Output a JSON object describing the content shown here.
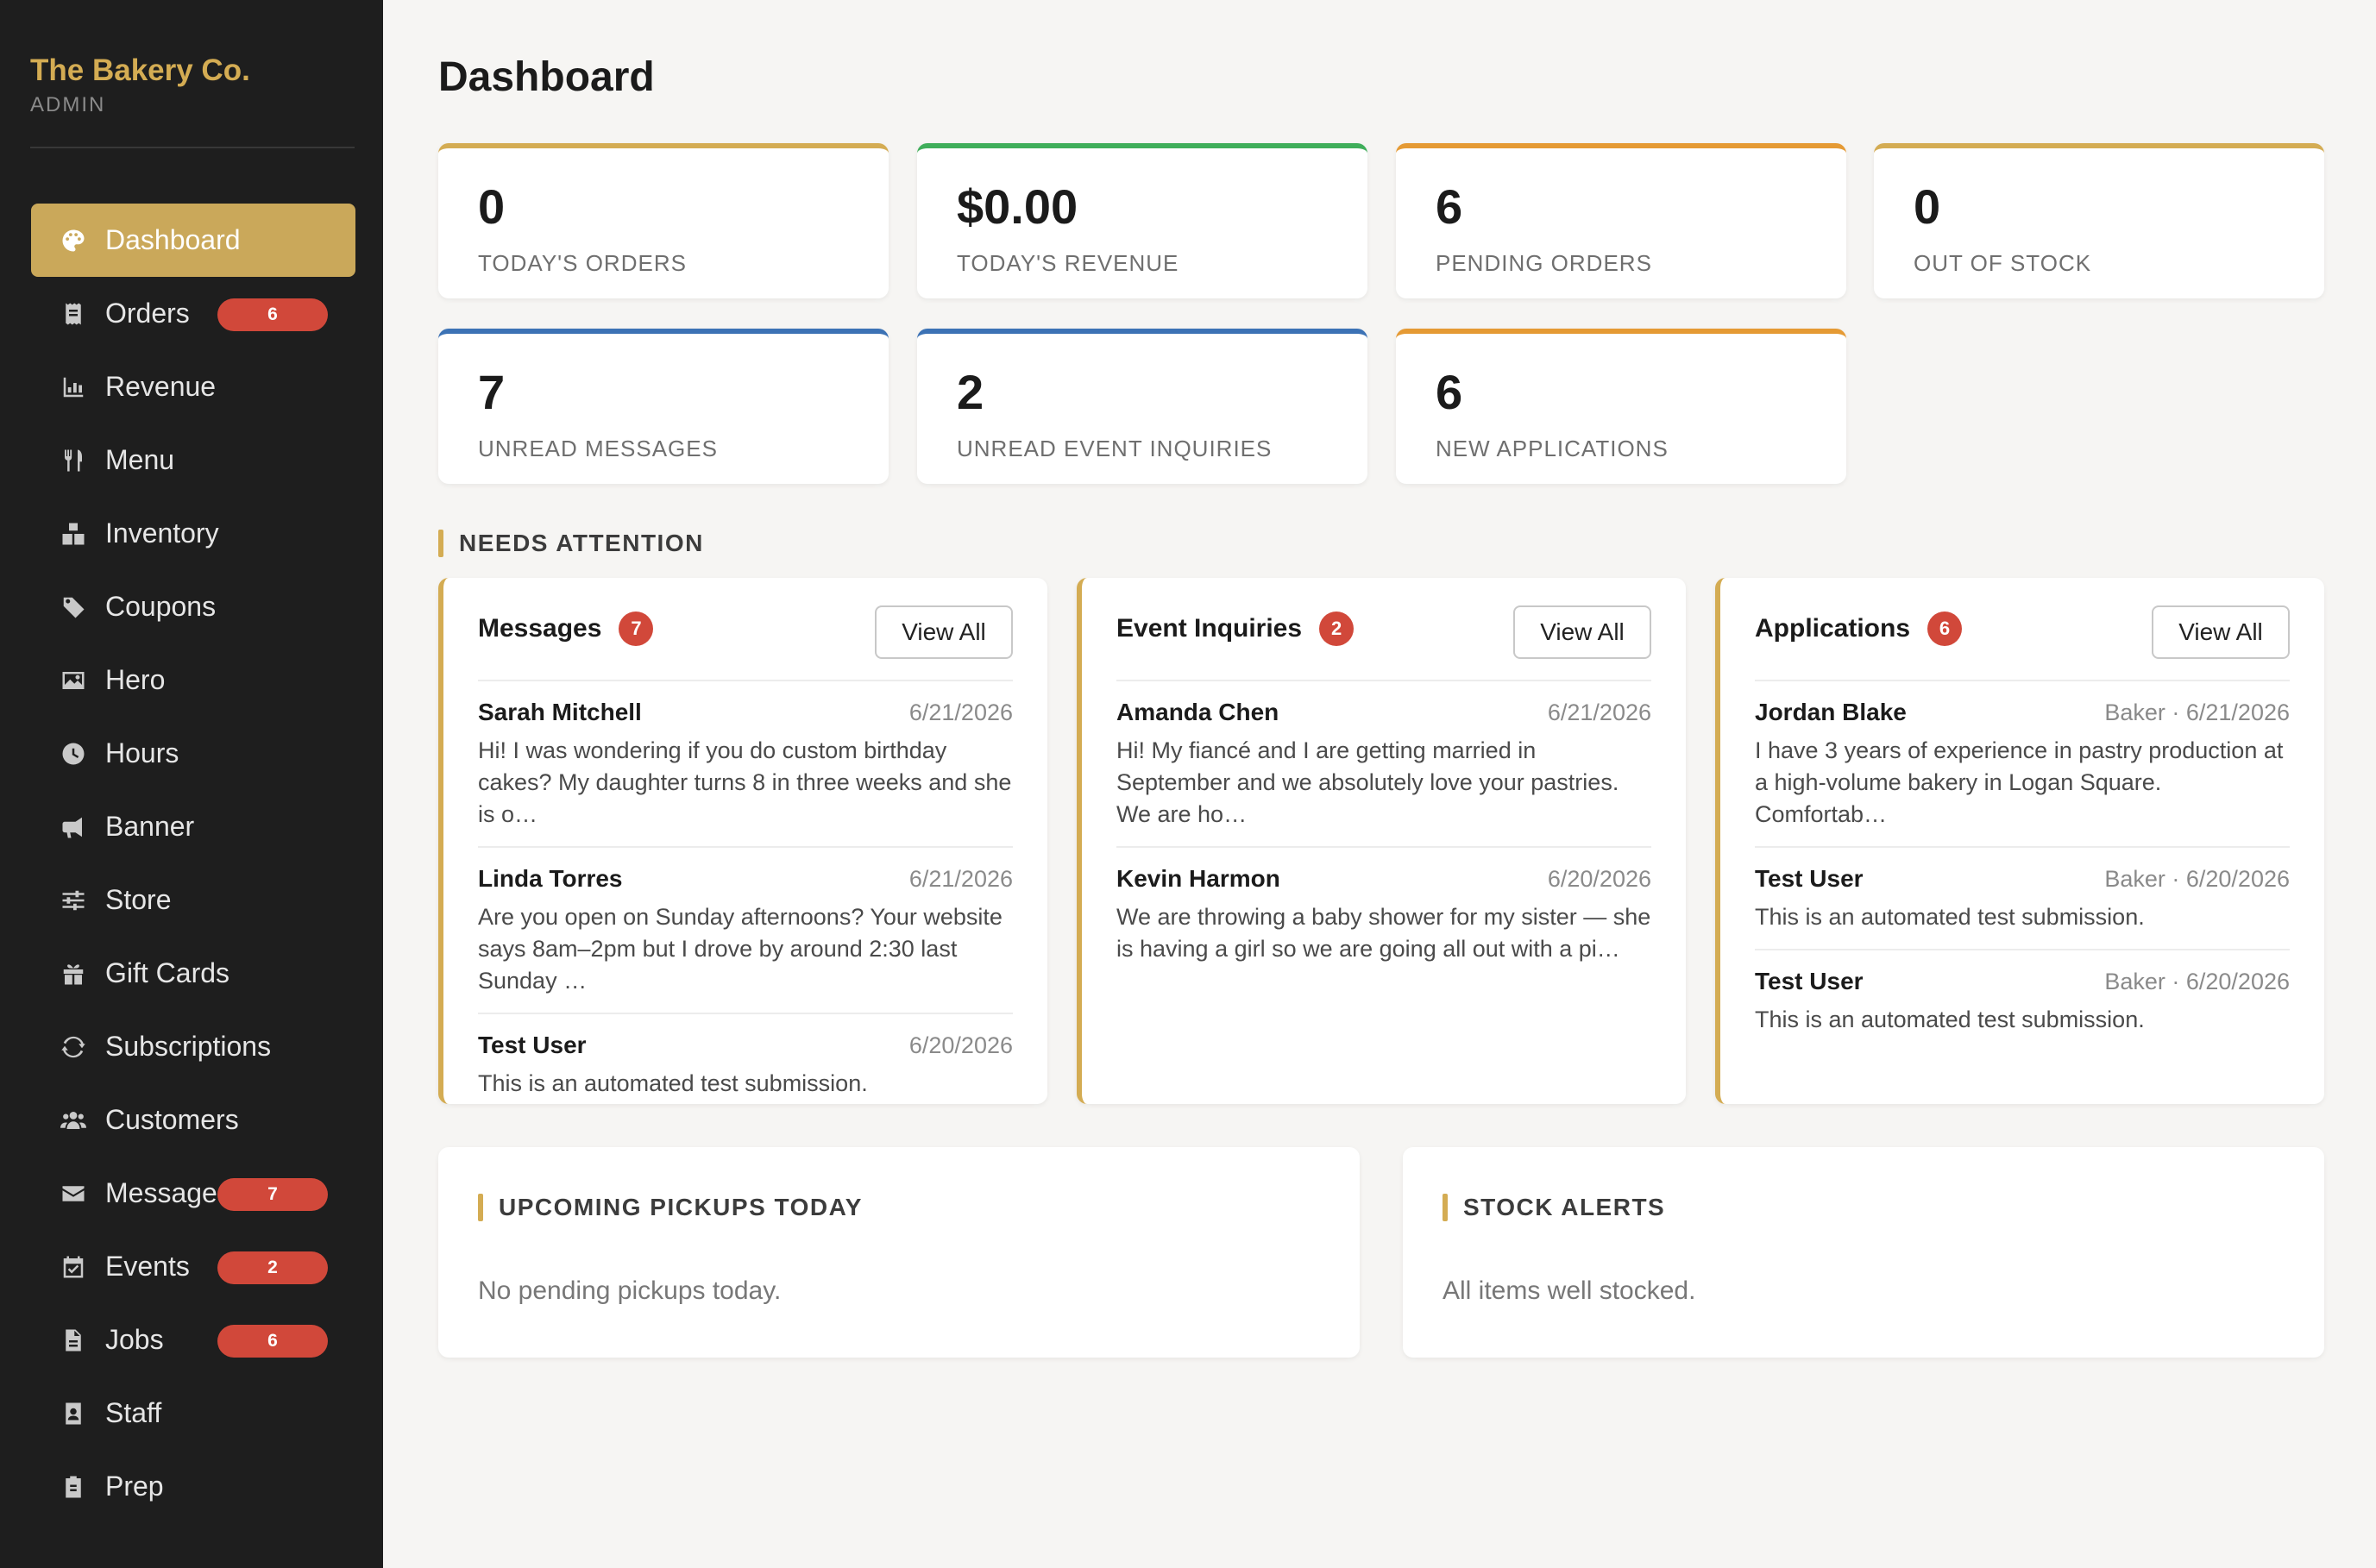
{
  "brand": {
    "name": "The Bakery Co.",
    "role": "ADMIN"
  },
  "sidebar": {
    "items": [
      {
        "label": "Dashboard",
        "icon": "palette-icon",
        "active": true,
        "badge": ""
      },
      {
        "label": "Orders",
        "icon": "receipt-icon",
        "badge": "6"
      },
      {
        "label": "Revenue",
        "icon": "bar-chart-icon",
        "badge": ""
      },
      {
        "label": "Menu",
        "icon": "utensils-icon",
        "badge": ""
      },
      {
        "label": "Inventory",
        "icon": "boxes-icon",
        "badge": ""
      },
      {
        "label": "Coupons",
        "icon": "tag-icon",
        "badge": ""
      },
      {
        "label": "Hero",
        "icon": "image-icon",
        "badge": ""
      },
      {
        "label": "Hours",
        "icon": "clock-icon",
        "badge": ""
      },
      {
        "label": "Banner",
        "icon": "megaphone-icon",
        "badge": ""
      },
      {
        "label": "Store",
        "icon": "sliders-icon",
        "badge": ""
      },
      {
        "label": "Gift Cards",
        "icon": "gift-icon",
        "badge": ""
      },
      {
        "label": "Subscriptions",
        "icon": "sync-icon",
        "badge": ""
      },
      {
        "label": "Customers",
        "icon": "users-icon",
        "badge": ""
      },
      {
        "label": "Messages",
        "icon": "envelope-icon",
        "badge": "7"
      },
      {
        "label": "Events",
        "icon": "calendar-check-icon",
        "badge": "2"
      },
      {
        "label": "Jobs",
        "icon": "file-icon",
        "badge": "6"
      },
      {
        "label": "Staff",
        "icon": "id-badge-icon",
        "badge": ""
      },
      {
        "label": "Prep",
        "icon": "clipboard-icon",
        "badge": ""
      }
    ]
  },
  "page": {
    "title": "Dashboard"
  },
  "stats": [
    {
      "value": "0",
      "label": "TODAY'S ORDERS",
      "accent": "#d4ac53"
    },
    {
      "value": "$0.00",
      "label": "TODAY'S REVENUE",
      "accent": "#3fae5a"
    },
    {
      "value": "6",
      "label": "PENDING ORDERS",
      "accent": "#e59a34"
    },
    {
      "value": "0",
      "label": "OUT OF STOCK",
      "accent": "#d4ac53"
    },
    {
      "value": "7",
      "label": "UNREAD MESSAGES",
      "accent": "#3c72b5"
    },
    {
      "value": "2",
      "label": "UNREAD EVENT INQUIRIES",
      "accent": "#3c72b5"
    },
    {
      "value": "6",
      "label": "NEW APPLICATIONS",
      "accent": "#e59a34"
    }
  ],
  "attention": {
    "title": "NEEDS ATTENTION",
    "view_all": "View All",
    "cards": [
      {
        "title": "Messages",
        "badge": "7",
        "entries": [
          {
            "name": "Sarah Mitchell",
            "meta": "6/21/2026",
            "text": "Hi! I was wondering if you do custom birthday cakes? My daughter turns 8 in three weeks and she is o…"
          },
          {
            "name": "Linda Torres",
            "meta": "6/21/2026",
            "text": "Are you open on Sunday afternoons? Your website says 8am–2pm but I drove by around 2:30 last Sunday …"
          },
          {
            "name": "Test User",
            "meta": "6/20/2026",
            "text": "This is an automated test submission."
          }
        ]
      },
      {
        "title": "Event Inquiries",
        "badge": "2",
        "entries": [
          {
            "name": "Amanda Chen",
            "meta": "6/21/2026",
            "text": "Hi! My fiancé and I are getting married in September and we absolutely love your pastries. We are ho…"
          },
          {
            "name": "Kevin Harmon",
            "meta": "6/20/2026",
            "text": "We are throwing a baby shower for my sister — she is having a girl so we are going all out with a pi…"
          }
        ]
      },
      {
        "title": "Applications",
        "badge": "6",
        "entries": [
          {
            "name": "Jordan Blake",
            "meta": "Baker · 6/21/2026",
            "text": "I have 3 years of experience in pastry production at a high-volume bakery in Logan Square. Comfortab…"
          },
          {
            "name": "Test User",
            "meta": "Baker · 6/20/2026",
            "text": "This is an automated test submission."
          },
          {
            "name": "Test User",
            "meta": "Baker · 6/20/2026",
            "text": "This is an automated test submission."
          }
        ]
      }
    ]
  },
  "pickups": {
    "title": "UPCOMING PICKUPS TODAY",
    "empty": "No pending pickups today."
  },
  "stock": {
    "title": "STOCK ALERTS",
    "empty": "All items well stocked."
  },
  "colors": {
    "accent": "#d4ac53",
    "sidebar_bg": "#1e1e1e",
    "badge": "#d1483a"
  }
}
